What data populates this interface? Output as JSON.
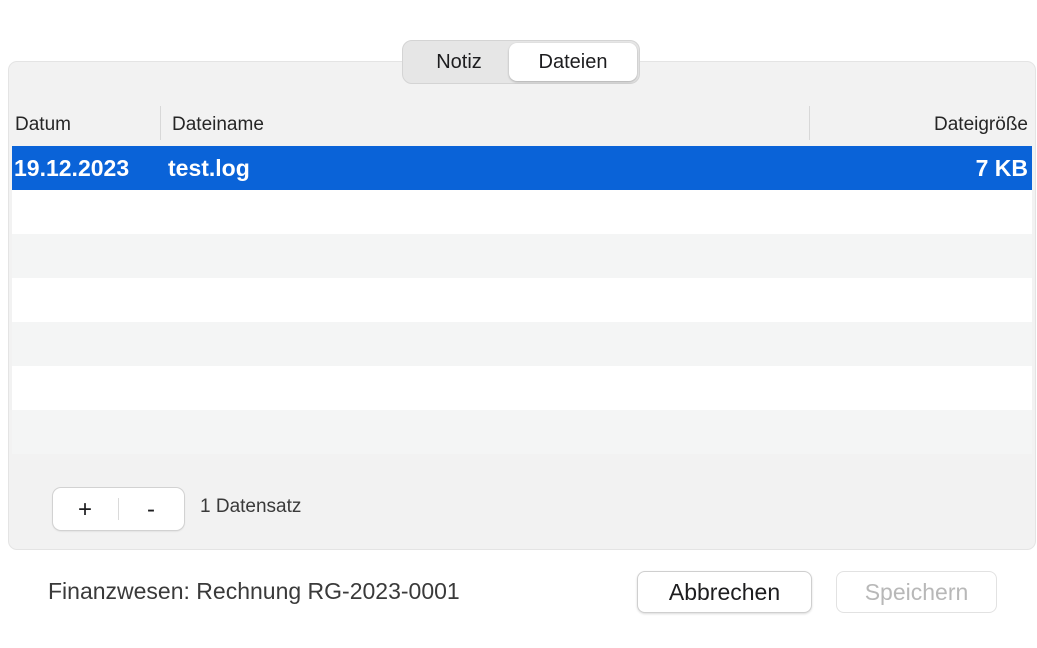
{
  "tabs": [
    {
      "label": "Notiz",
      "selected": false
    },
    {
      "label": "Dateien",
      "selected": true
    }
  ],
  "table": {
    "columns": {
      "date": "Datum",
      "name": "Dateiname",
      "size": "Dateigröße"
    },
    "rows": [
      {
        "date": "19.12.2023",
        "name": "test.log",
        "size": "7 KB",
        "selected": true
      }
    ]
  },
  "toolbar": {
    "add_label": "+",
    "remove_label": "-",
    "record_count": "1 Datensatz"
  },
  "footer": {
    "context": "Finanzwesen: Rechnung RG-2023-0001",
    "cancel_label": "Abbrechen",
    "save_label": "Speichern",
    "save_enabled": false
  },
  "colors": {
    "selection": "#0a63d8",
    "stripe": "#f4f5f5",
    "groupbox": "#f2f2f2"
  }
}
